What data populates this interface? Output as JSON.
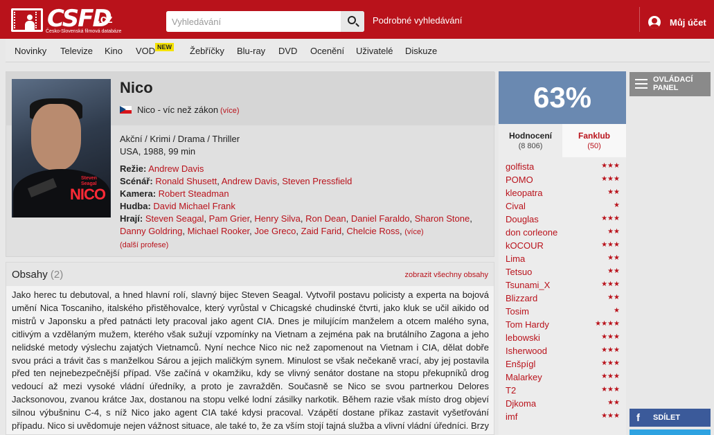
{
  "header": {
    "logo_text": "CSFD",
    "logo_tld": ".cz",
    "logo_subtitle": "Česko-Slovenská filmová databáze",
    "search_placeholder": "Vyhledávání",
    "advanced_search": "Podrobné vyhledávání",
    "account": "Můj účet"
  },
  "nav": {
    "items": [
      "Novinky",
      "Televize",
      "Kino",
      "VOD",
      "Žebříčky",
      "Blu-ray",
      "DVD",
      "Ocenění",
      "Uživatelé",
      "Diskuze"
    ],
    "vod_badge": "NEW"
  },
  "film": {
    "title": "Nico",
    "alt_title": "Nico - víc než zákon",
    "alt_more": "(více)",
    "genres": "Akční / Krimi / Drama / Thriller",
    "origin": "USA, 1988, 99 min",
    "poster": {
      "actor_line1": "Steven",
      "actor_line2": "Seagal",
      "title": "NICO"
    },
    "director_label": "Režie:",
    "director": "Andrew Davis",
    "writers_label": "Scénář:",
    "writers": [
      "Ronald Shusett",
      "Andrew Davis",
      "Steven Pressfield"
    ],
    "camera_label": "Kamera:",
    "camera": "Robert Steadman",
    "music_label": "Hudba:",
    "music": "David Michael Frank",
    "cast_label": "Hrají:",
    "cast": [
      "Steven Seagal",
      "Pam Grier",
      "Henry Silva",
      "Ron Dean",
      "Daniel Faraldo",
      "Sharon Stone",
      "Danny Goldring",
      "Michael Rooker",
      "Joe Greco",
      "Zaid Farid",
      "Chelcie Ross"
    ],
    "cast_more": "(více)",
    "more_professions": "(další profese)"
  },
  "plot": {
    "title": "Obsahy",
    "count": "(2)",
    "show_all": "zobrazit všechny obsahy",
    "text": "Jako herec tu debutoval, a hned hlavní rolí, slavný bijec Steven Seagal. Vytvořil postavu policisty a experta na bojová umění Nica Toscaniho, italského přistěhovalce, který vyrůstal v Chicagské chudinské čtvrti, jako kluk se učil aikido od mistrů v Japonsku a před patnácti lety pracoval jako agent CIA. Dnes je milujícím manželem a otcem malého syna, citlivým a vzdělaným mužem, kterého však sužují vzpomínky na Vietnam a zejména pak na brutálního Zagona a jeho nelidské metody výslechu zajatých Vietnamců. Nyní nechce Nico nic než zapomenout na Vietnam i CIA, dělat dobře svou práci a trávit čas s manželkou Sárou a jejich maličkým synem. Minulost se však nečekaně vrací, aby jej postavila před ten nejnebezpečnější případ. Vše začíná v okamžiku, kdy se vlivný senátor dostane na stopu překupníků drog vedoucí až mezi vysoké vládní úředníky, a proto je zavražděn. Současně se Nico se svou partnerkou Delores Jacksonovou, zvanou krátce Jax, dostanou na stopu velké lodní zásilky narkotik. Během razie však místo drog objeví silnou výbušninu C-4, s níž Nico jako agent CIA také kdysi pracoval. Vzápětí dostane příkaz zastavit vyšetřování případu. Nico si uvědomuje nejen vážnost situace, ale také to, že za vším stojí tajná služba a vlivní vládní úředníci. Brzy poté mu volá bývalý přítel z CIA, aby ho varoval a vzápětí je donucen odevzdat odznak a pistoli, protože odmítl z"
  },
  "rating": {
    "percent": "63%",
    "tab_ratings": "Hodnocení",
    "tab_ratings_count": "(8 806)",
    "tab_fanclub": "Fanklub",
    "tab_fanclub_count": "(50)",
    "users": [
      {
        "name": "golfista",
        "stars": 3
      },
      {
        "name": "POMO",
        "stars": 3
      },
      {
        "name": "kleopatra",
        "stars": 2
      },
      {
        "name": "Cival",
        "stars": 1
      },
      {
        "name": "Douglas",
        "stars": 3
      },
      {
        "name": "don corleone",
        "stars": 2
      },
      {
        "name": "kOCOUR",
        "stars": 3
      },
      {
        "name": "Lima",
        "stars": 2
      },
      {
        "name": "Tetsuo",
        "stars": 2
      },
      {
        "name": "Tsunami_X",
        "stars": 3
      },
      {
        "name": "Blizzard",
        "stars": 2
      },
      {
        "name": "Tosim",
        "stars": 1
      },
      {
        "name": "Tom Hardy",
        "stars": 4
      },
      {
        "name": "lebowski",
        "stars": 3
      },
      {
        "name": "Isherwood",
        "stars": 3
      },
      {
        "name": "Enšpígl",
        "stars": 3
      },
      {
        "name": "Malarkey",
        "stars": 3
      },
      {
        "name": "T2",
        "stars": 3
      },
      {
        "name": "Djkoma",
        "stars": 2
      },
      {
        "name": "imf",
        "stars": 3
      }
    ]
  },
  "side": {
    "panel_label_1": "OVLÁDACÍ",
    "panel_label_2": "PANEL",
    "share": "SDÍLET"
  },
  "colors": {
    "brand": "#b9121b",
    "rating_bg": "#6a89b1",
    "facebook": "#3b5a9a"
  }
}
